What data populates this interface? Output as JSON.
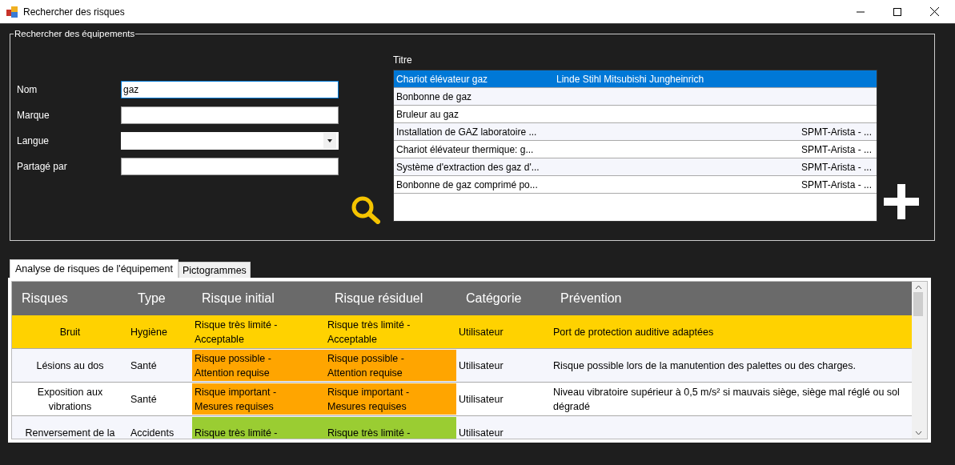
{
  "window": {
    "title": "Rechercher des risques"
  },
  "search_group": {
    "title": "Rechercher des équipements",
    "fields": [
      {
        "label": "Nom",
        "value": "gaz",
        "kind": "text",
        "focused": true
      },
      {
        "label": "Marque",
        "kind": "text",
        "focused": false
      },
      {
        "label": "Langue",
        "kind": "dropdown",
        "focused": false
      },
      {
        "label": "Partagé par",
        "kind": "text",
        "focused": false
      }
    ],
    "results_label": "Titre",
    "results": [
      {
        "title": "Chariot élévateur gaz",
        "brand": "Linde Stihl Mitsubishi Jungheinrich",
        "selected": true
      },
      {
        "title": "Bonbonne de gaz",
        "selected": false
      },
      {
        "title": "Bruleur au gaz",
        "selected": false
      },
      {
        "title": "Installation de GAZ laboratoire ...",
        "shared_by": "SPMT-Arista - ...",
        "selected": false
      },
      {
        "title": "Chariot élévateur thermique: g...",
        "shared_by": "SPMT-Arista - ...",
        "selected": false
      },
      {
        "title": "Système d'extraction des gaz d'...",
        "shared_by": "SPMT-Arista - ...",
        "selected": false
      },
      {
        "title": "Bonbonne de gaz comprimé po...",
        "shared_by": "SPMT-Arista - ...",
        "selected": false
      }
    ]
  },
  "tabs": [
    {
      "label": "Analyse de risques de l'équipement",
      "selected": true
    },
    {
      "label": "Pictogrammes",
      "selected": false
    }
  ],
  "table": {
    "columns": [
      "Risques",
      "Type",
      "Risque initial",
      "Risque résiduel",
      "Catégorie",
      "Prévention"
    ],
    "rows": [
      {
        "risk": "Bruit",
        "type": "Hygiène",
        "initial": {
          "text": "Risque très limité - Acceptable",
          "color": "#ffd200"
        },
        "residual": {
          "text": "Risque très limité - Acceptable",
          "color": "#ffd200"
        },
        "category": "Utilisateur",
        "prevention": "Port de protection auditive adaptées",
        "highlighted": true
      },
      {
        "risk": "Lésions au dos",
        "type": "Santé",
        "initial": {
          "text": "Risque possible - Attention requise",
          "color": "#ffa500"
        },
        "residual": {
          "text": "Risque possible - Attention requise",
          "color": "#ffa500"
        },
        "category": "Utilisateur",
        "prevention": "Risque possible lors de la manutention des palettes ou des charges.",
        "highlighted": false
      },
      {
        "risk": "Exposition aux vibrations",
        "type": "Santé",
        "initial": {
          "text": "Risque important - Mesures requises",
          "color": "#ffa500"
        },
        "residual": {
          "text": "Risque important - Mesures requises",
          "color": "#ffa500"
        },
        "category": "Utilisateur",
        "prevention": "Niveau vibratoire supérieur à 0,5 m/s² si mauvais siège, siège mal réglé ou sol dégradé",
        "highlighted": false
      },
      {
        "risk": "Renversement de la",
        "type": "Accidents",
        "initial": {
          "text": "Risque très limité -",
          "color": "#9acd32"
        },
        "residual": {
          "text": "Risque très limité -",
          "color": "#9acd32"
        },
        "category": "Utilisateur",
        "highlighted": false
      }
    ]
  }
}
